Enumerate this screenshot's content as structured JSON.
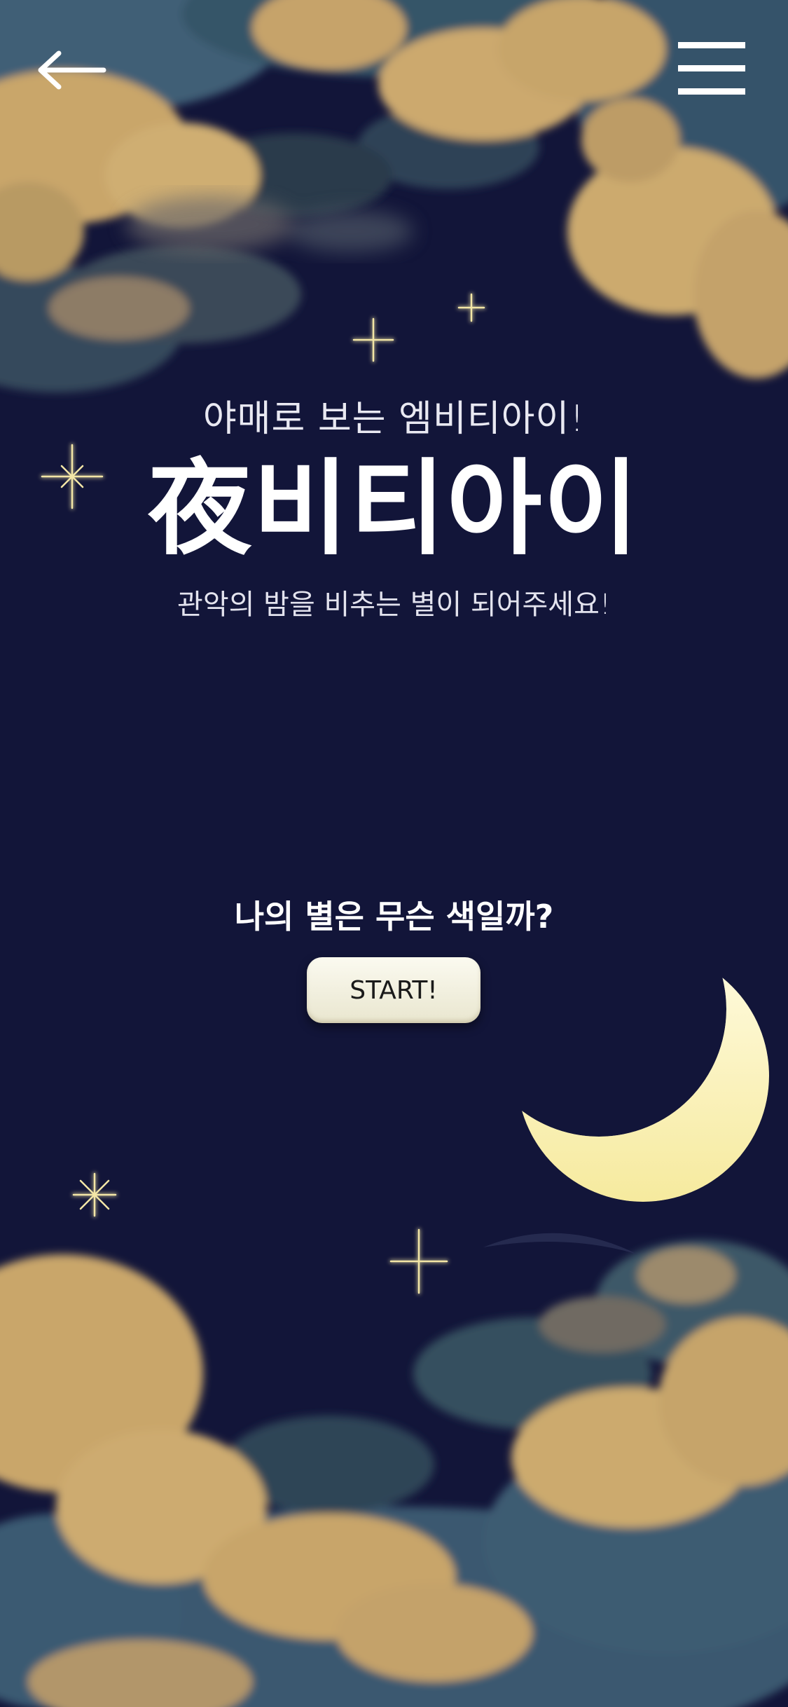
{
  "screen": {
    "subtitle": "야매로 보는 엠비티아이!",
    "title": "夜비티아이",
    "tagline": "관악의 밤을 비추는 별이 되어주세요!",
    "question": "나의 별은 무슨 색일까?",
    "start_label": "START!"
  },
  "icons": {
    "back": "arrow-left-icon",
    "menu": "hamburger-menu-icon"
  },
  "colors": {
    "sky": "#121539",
    "cloud": "#c9a66b",
    "cloud_shadow": "#3f5f76",
    "moon": "#fbf6c8",
    "star": "#f3e6a6",
    "button": "#f7f5e6"
  }
}
